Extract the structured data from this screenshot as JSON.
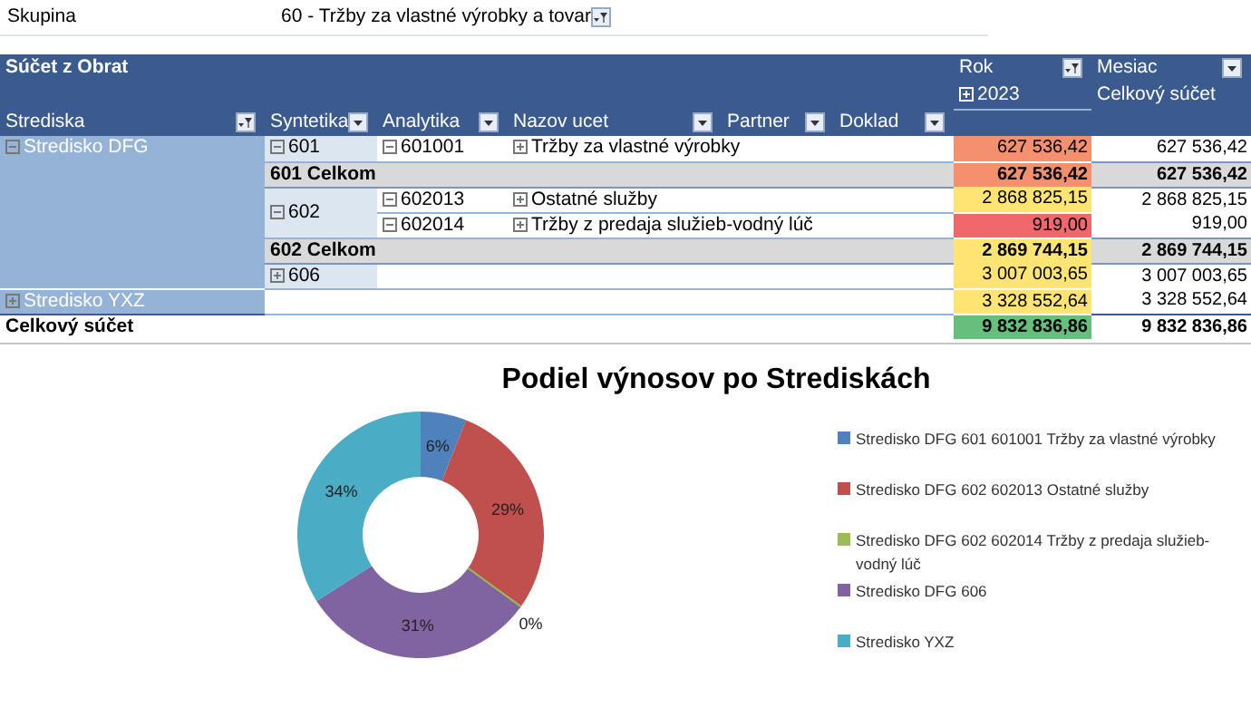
{
  "filter": {
    "label": "Skupina",
    "value": "60 - Tržby za vlastné výrobky a tovar",
    "filtered": true
  },
  "pivot": {
    "data_label": "Súčet z Obrat",
    "column_fields": [
      {
        "label": "Rok",
        "filtered": true
      },
      {
        "label": "Mesiac",
        "filtered": false
      }
    ],
    "column_item": {
      "label": "2023",
      "expanded": false
    },
    "grand_total_header": "Celkový súčet",
    "row_fields": [
      {
        "label": "Strediska",
        "filtered": true
      },
      {
        "label": "Syntetika",
        "filtered": false
      },
      {
        "label": "Analytika",
        "filtered": false
      },
      {
        "label": "Nazov ucet",
        "filtered": false
      },
      {
        "label": "Partner",
        "filtered": false
      },
      {
        "label": "Doklad",
        "filtered": false
      }
    ],
    "strediska": [
      {
        "label": "Stredisko DFG",
        "expanded": true,
        "syntetika": [
          {
            "label": "601",
            "expanded": true,
            "analytika": [
              {
                "label": "601001",
                "expanded": true,
                "nazov": "Tržby za vlastné výrobky",
                "nazov_expanded": false,
                "value": "627 536,42",
                "total": "627 536,42",
                "color": "#f4906e"
              }
            ],
            "subtotal": {
              "label": "601 Celkom",
              "value": "627 536,42",
              "total": "627 536,42",
              "color": "#f4906e"
            }
          },
          {
            "label": "602",
            "expanded": true,
            "analytika": [
              {
                "label": "602013",
                "expanded": true,
                "nazov": "Ostatné služby",
                "nazov_expanded": false,
                "value": "2 868 825,15",
                "total": "2 868 825,15",
                "color": "#fde473"
              },
              {
                "label": "602014",
                "expanded": true,
                "nazov": "Tržby z predaja služieb-vodný lúč",
                "nazov_expanded": false,
                "value": "919,00",
                "total": "919,00",
                "color": "#f0686b"
              }
            ],
            "subtotal": {
              "label": "602 Celkom",
              "value": "2 869 744,15",
              "total": "2 869 744,15",
              "color": "#fde473"
            }
          },
          {
            "label": "606",
            "expanded": false,
            "value": "3 007 003,65",
            "total": "3 007 003,65",
            "color": "#fde473"
          }
        ]
      },
      {
        "label": "Stredisko YXZ",
        "expanded": false,
        "value": "3 328 552,64",
        "total": "3 328 552,64",
        "color": "#fde473"
      }
    ],
    "grand_total": {
      "label": "Celkový súčet",
      "value": "9 832 836,86",
      "total": "9 832 836,86",
      "color": "#66bf7c"
    }
  },
  "chart": {
    "chart_data": {
      "type": "donut",
      "title": "Podiel výnosov po Strediskách",
      "categories": [
        "Stredisko DFG 601 601001 Tržby za vlastné výrobky",
        "Stredisko DFG 602 602013 Ostatné služby",
        "Stredisko DFG 602 602014 Tržby z predaja služieb-vodný lúč",
        "Stredisko DFG 606",
        "Stredisko YXZ"
      ],
      "series": [
        {
          "values": [
            6,
            29,
            0,
            31,
            34
          ],
          "colors": [
            "#4f81bd",
            "#c0504d",
            "#9bbb59",
            "#8064a2",
            "#4bacc6"
          ]
        }
      ],
      "legend": true,
      "value_labels": [
        "6%",
        "29%",
        "0%",
        "31%",
        "34%"
      ]
    }
  }
}
